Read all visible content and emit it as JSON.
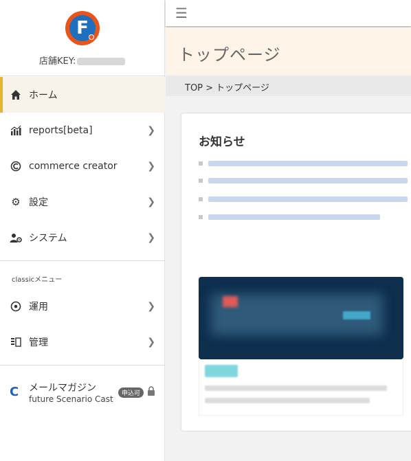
{
  "brand": {
    "logo_letter": "F",
    "store_key_label": "店舗KEY:"
  },
  "sidebar": {
    "items": [
      {
        "label": "ホーム",
        "icon": "home-icon"
      },
      {
        "label": "reports[beta]",
        "icon": "bar-chart-icon"
      },
      {
        "label": "commerce creator",
        "icon": "commerce-creator-icon"
      },
      {
        "label": "設定",
        "icon": "gear-icon"
      },
      {
        "label": "システム",
        "icon": "user-gear-icon"
      }
    ],
    "classic_section_label": "classicメニュー",
    "classic_items": [
      {
        "label": "運用",
        "icon": "cog-refresh-icon"
      },
      {
        "label": "管理",
        "icon": "manage-icon"
      }
    ],
    "mail_magazine": {
      "title": "メールマガジン",
      "subtitle": "future Scenario Cast",
      "badge": "申込可",
      "icon": "mail-magazine-icon"
    }
  },
  "topbar": {
    "menu_icon": "hamburger-icon"
  },
  "page": {
    "title": "トップページ",
    "breadcrumb": "TOP > トップページ"
  },
  "news": {
    "title": "お知らせ"
  },
  "colors": {
    "accent": "#e9b32d",
    "active_bg": "#f8f3e9",
    "header_bg": "#fdf3e6",
    "logo_orange": "#e8541a",
    "logo_blue": "#1f6fbf"
  }
}
